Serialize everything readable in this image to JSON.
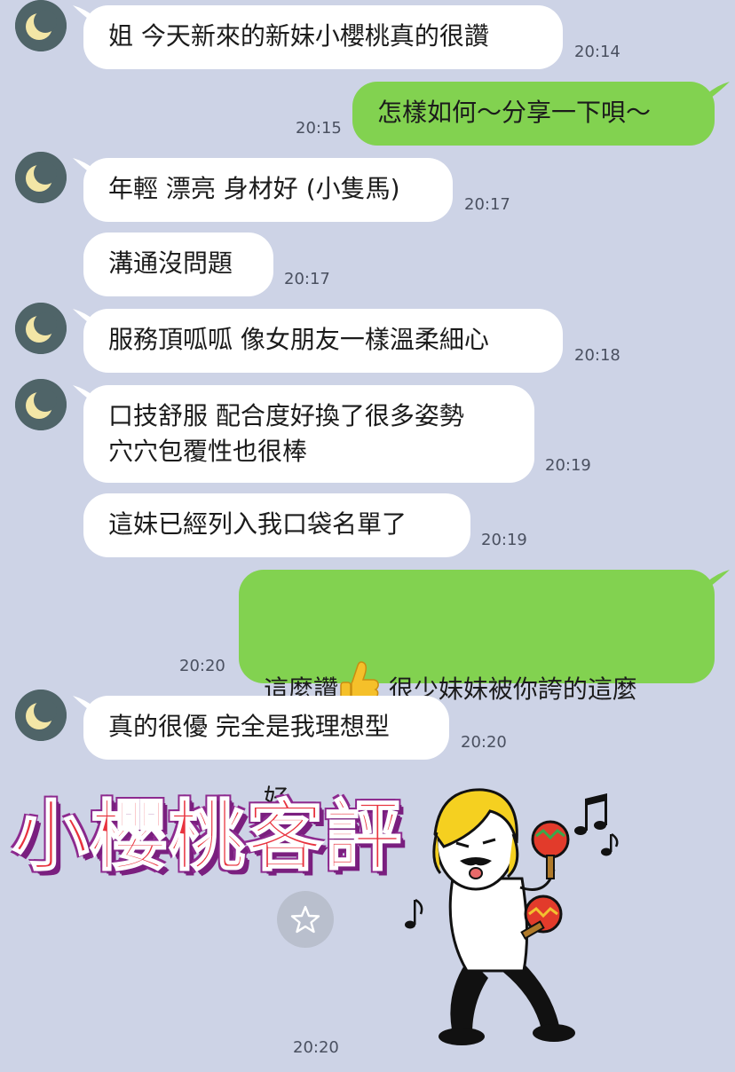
{
  "messages": [
    {
      "side": "in",
      "avatar": true,
      "text": "姐 今天新來的新妹小櫻桃真的很讚",
      "time": "20:14"
    },
    {
      "side": "out",
      "text": "怎樣如何～分享一下唄～",
      "time": "20:15"
    },
    {
      "side": "in",
      "avatar": true,
      "text": "年輕 漂亮 身材好 (小隻馬)",
      "time": "20:17"
    },
    {
      "side": "in",
      "avatar": false,
      "text": "溝通沒問題",
      "time": "20:17"
    },
    {
      "side": "in",
      "avatar": true,
      "text": "服務頂呱呱 像女朋友一樣溫柔細心",
      "time": "20:18"
    },
    {
      "side": "in",
      "avatar": true,
      "text_line1": "口技舒服 配合度好換了很多姿勢",
      "text_line2": "穴穴包覆性也很棒",
      "time": "20:19"
    },
    {
      "side": "in",
      "avatar": false,
      "text": "這妹已經列入我口袋名單了",
      "time": "20:19"
    },
    {
      "side": "out",
      "text_before_emoji": "這麼讚",
      "emoji": "thumbs-up-icon",
      "text_after_emoji": " 很少妹妹被你誇的這麼",
      "text_line2": "好",
      "time": "20:20"
    },
    {
      "side": "in",
      "avatar": true,
      "text": "真的很優 完全是我理想型",
      "time": "20:20"
    }
  ],
  "sticker": {
    "overlay_text": "小櫻桃客評",
    "icon": "dancing-character-sticker",
    "favorite_icon": "star-icon",
    "time": "20:20"
  },
  "colors": {
    "background": "#cdd3e6",
    "incoming_bubble": "#ffffff",
    "outgoing_bubble": "#82d250",
    "avatar": "#4f6468",
    "moon": "#f3e6a6"
  }
}
